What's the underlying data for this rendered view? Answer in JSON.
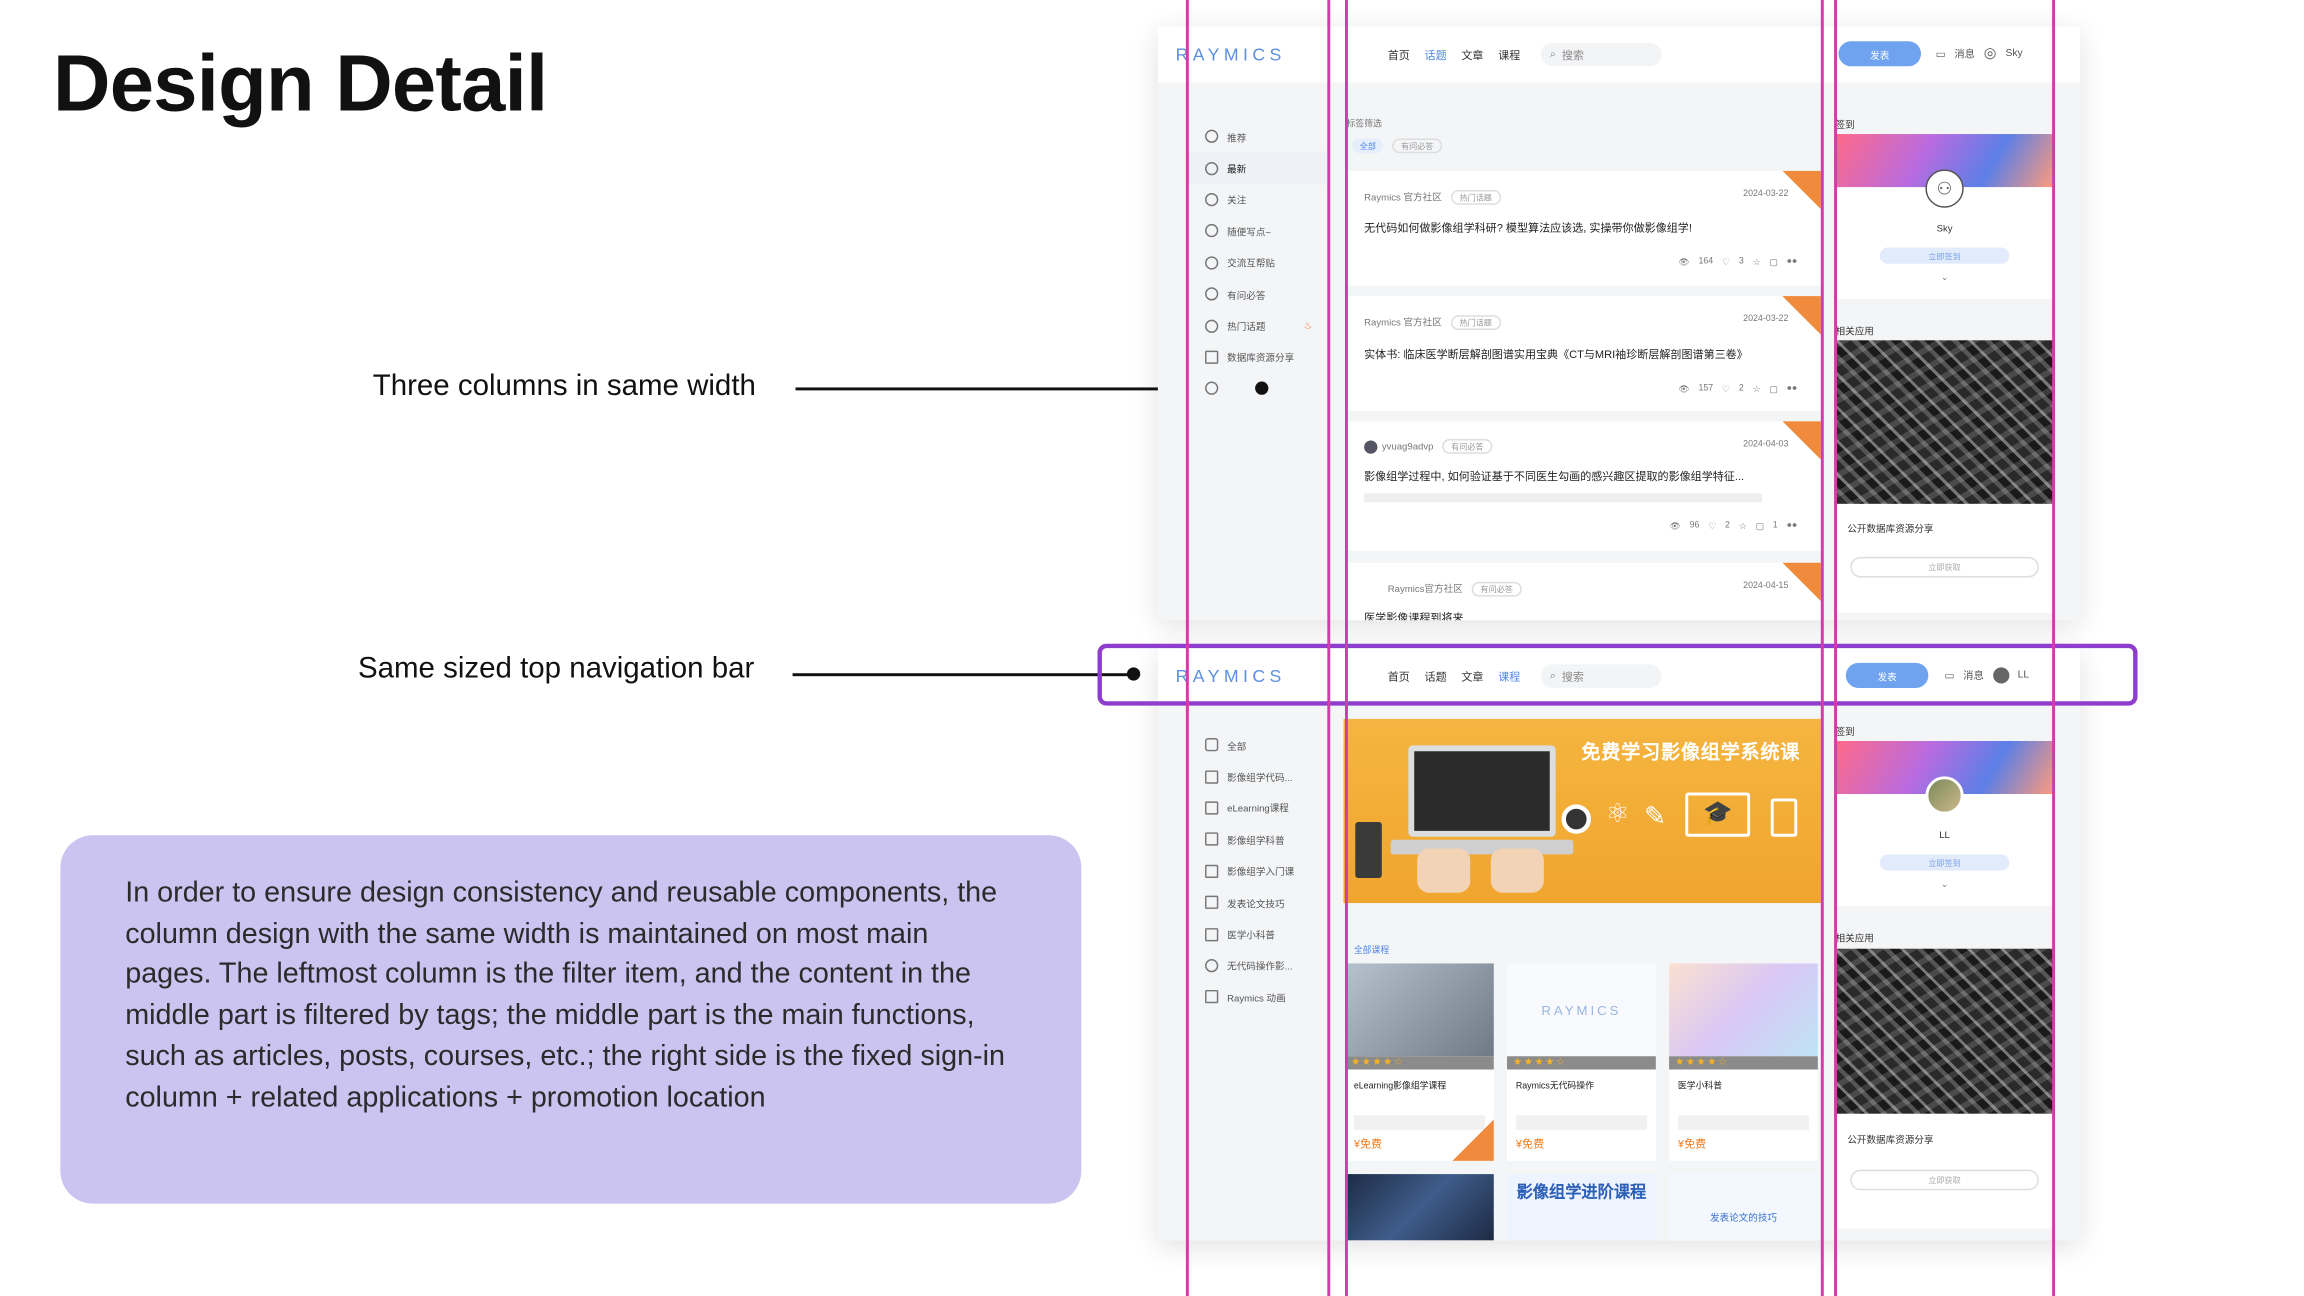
{
  "slide": {
    "title": "Design Detail",
    "callout_columns": "Three columns in same width",
    "callout_navbar": "Same sized top navigation bar",
    "note": "In order to ensure design consistency and reusable components, the column design with the same width is maintained on most main pages. The leftmost column is the filter item, and the content in the middle part is filtered by tags; the middle part is the main functions, such as articles, posts, courses, etc.; the right side is the fixed sign-in column + related applications + promotion location"
  },
  "colors": {
    "guide": "#cc3fa8",
    "highlight": "#8f3dcc",
    "accent": "#4e86e8",
    "note_bg": "#cbc3f0"
  },
  "top_mock": {
    "logo": "RAYMICS",
    "nav": [
      "首页",
      "话题",
      "文章",
      "课程"
    ],
    "active_nav": "话题",
    "search_placeholder": "搜索",
    "post_button": "发表",
    "messages": "消息",
    "user": "Sky",
    "side_items": [
      "推荐",
      "最新",
      "关注",
      "随便写点~",
      "交流互帮贴",
      "有问必答",
      "热门话题",
      "数据库资源分享"
    ],
    "filter_label": "标签筛选",
    "filter_tags": [
      "全部",
      "有问必答"
    ],
    "posts": [
      {
        "author": "Raymics 官方社区",
        "tag": "热门话题",
        "date": "2024-03-22",
        "title": "无代码如何做影像组学科研? 模型算法应该选, 实操带你做影像组学!",
        "views": "164",
        "likes": "3"
      },
      {
        "author": "Raymics 官方社区",
        "tag": "热门话题",
        "date": "2024-03-22",
        "title": "实体书: 临床医学断层解剖图谱实用宝典《CT与MRI袖珍断层解剖图谱第三卷》",
        "views": "157",
        "likes": "2"
      },
      {
        "author": "yvuag9advp",
        "tag": "有问必答",
        "date": "2024-04-03",
        "title": "影像组学过程中, 如何验证基于不同医生勾画的感兴趣区提取的影像组学特征...",
        "views": "96",
        "likes": "2",
        "comments": "1"
      },
      {
        "author": "Raymics官方社区",
        "tag": "有问必答",
        "date": "2024-04-15",
        "title": "医学影像课程到将来"
      }
    ],
    "sign_in": "签到",
    "sign_button": "立即签到",
    "related_apps": "相关应用",
    "app_caption": "公开数据库资源分享",
    "app_button": "立即获取"
  },
  "bottom_mock": {
    "logo": "RAYMICS",
    "nav": [
      "首页",
      "话题",
      "文章",
      "课程"
    ],
    "active_nav": "课程",
    "search_placeholder": "搜索",
    "post_button": "发表",
    "messages": "消息",
    "user": "LL",
    "side_items": [
      "全部",
      "影像组学代码...",
      "eLearning课程",
      "影像组学科普",
      "影像组学入门课",
      "发表论文技巧",
      "医学小科普",
      "无代码操作影...",
      "Raymics 动画"
    ],
    "banner_text": "免费学习影像组学系统课",
    "all_courses": "全部课程",
    "courses": [
      {
        "title": "eLearning影像组学课程",
        "price": "¥免费"
      },
      {
        "title": "Raymics无代码操作",
        "price": "¥免费"
      },
      {
        "title": "医学小科普",
        "price": "¥免费"
      }
    ],
    "course2_logo": "RAYMICS",
    "promo_advanced": "影像组学进阶课程",
    "promo_paper": "发表论文的技巧",
    "sign_in": "签到",
    "sign_button": "立即签到",
    "related_apps": "相关应用",
    "app_caption": "公开数据库资源分享",
    "app_button": "立即获取"
  }
}
